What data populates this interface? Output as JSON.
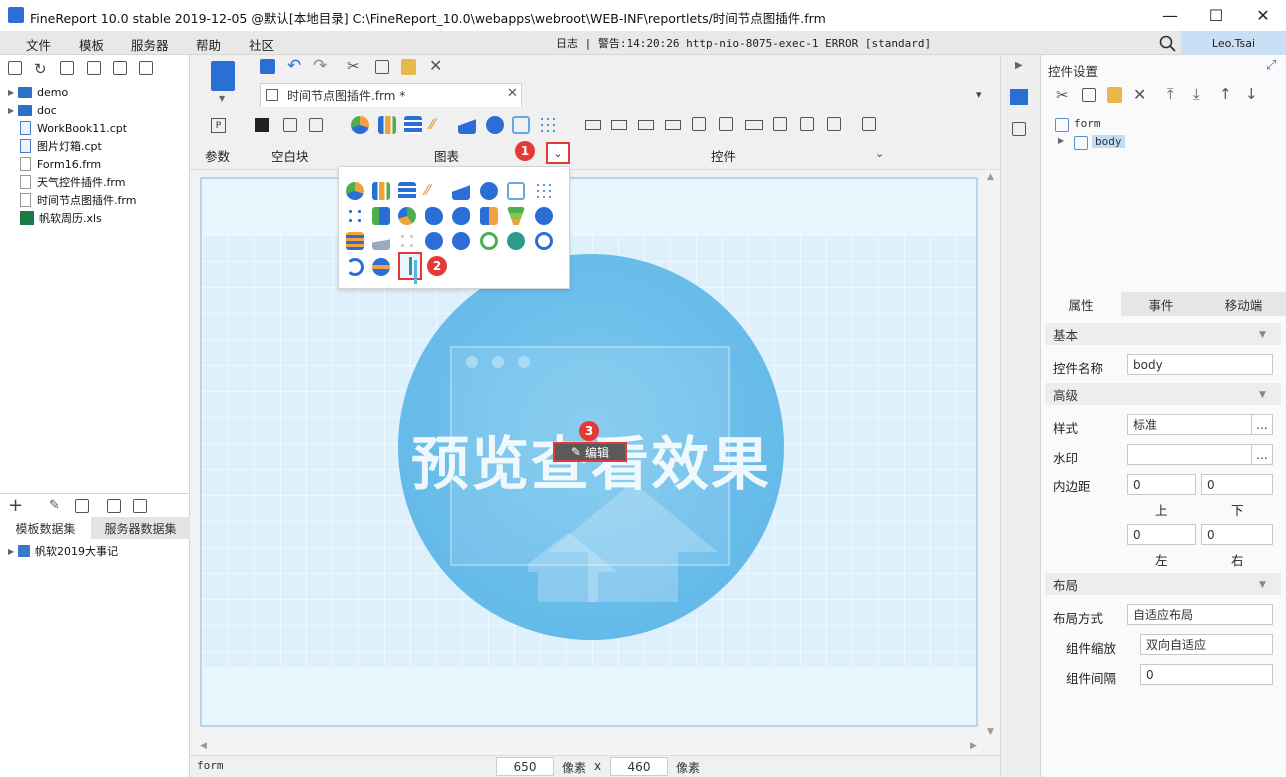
{
  "window": {
    "title": "FineReport 10.0 stable 2019-12-05 @默认[本地目录]     C:\\FineReport_10.0\\webapps\\webroot\\WEB-INF\\reportlets/时间节点图插件.frm",
    "minimize": "—",
    "maximize": "☐",
    "close": "✕"
  },
  "menu": {
    "items": [
      "文件",
      "模板",
      "服务器",
      "帮助",
      "社区"
    ],
    "status": "日志 | 警告:14:20:26 http-nio-8075-exec-1 ERROR [standard]",
    "user": "Leo.Tsai"
  },
  "file_tree": [
    {
      "type": "folder",
      "name": "demo"
    },
    {
      "type": "folder",
      "name": "doc"
    },
    {
      "type": "cpt",
      "name": "WorkBook11.cpt"
    },
    {
      "type": "cpt",
      "name": "图片灯箱.cpt"
    },
    {
      "type": "frm",
      "name": "Form16.frm"
    },
    {
      "type": "frm",
      "name": "天气控件插件.frm"
    },
    {
      "type": "frm",
      "name": "时间节点图插件.frm"
    },
    {
      "type": "xls",
      "name": "帆软周历.xls"
    }
  ],
  "datasets": {
    "tabs": [
      "模板数据集",
      "服务器数据集"
    ],
    "items": [
      "帆软2019大事记"
    ]
  },
  "editor": {
    "doc_tab": "时间节点图插件.frm *",
    "groups": {
      "params": "参数",
      "blank": "空白块",
      "chart": "图表",
      "widget": "控件"
    },
    "preview_text": "预览查看效果",
    "edit_label": "编辑",
    "badges": [
      "1",
      "2",
      "3"
    ],
    "bottom": {
      "form_label": "form",
      "width": "650",
      "unit1": "像素",
      "x": "x",
      "height": "460",
      "unit2": "像素"
    }
  },
  "right_panel": {
    "header": "控件设置",
    "tree": {
      "root": "form",
      "child": "body"
    },
    "tabs": [
      "属性",
      "事件",
      "移动端"
    ],
    "basic": {
      "section": "基本",
      "name_label": "控件名称",
      "name_value": "body"
    },
    "advanced": {
      "section": "高级",
      "style_label": "样式",
      "style_value": "标准",
      "watermark_label": "水印",
      "watermark_value": "",
      "padding_label": "内边距",
      "padding_top": "0",
      "padding_bottom": "0",
      "padding_left": "0",
      "padding_right": "0",
      "top_label": "上",
      "bottom_label": "下",
      "left_label": "左",
      "right_label": "右",
      "more": "..."
    },
    "layout": {
      "section": "布局",
      "mode_label": "布局方式",
      "mode_value": "自适应布局",
      "scale_label": "组件缩放",
      "scale_value": "双向自适应",
      "gap_label": "组件间隔",
      "gap_value": "0"
    }
  },
  "colors": {
    "accent_blue": "#2b6fd6",
    "badge_red": "#e53935",
    "canvas_blue": "#5bb4e6"
  }
}
